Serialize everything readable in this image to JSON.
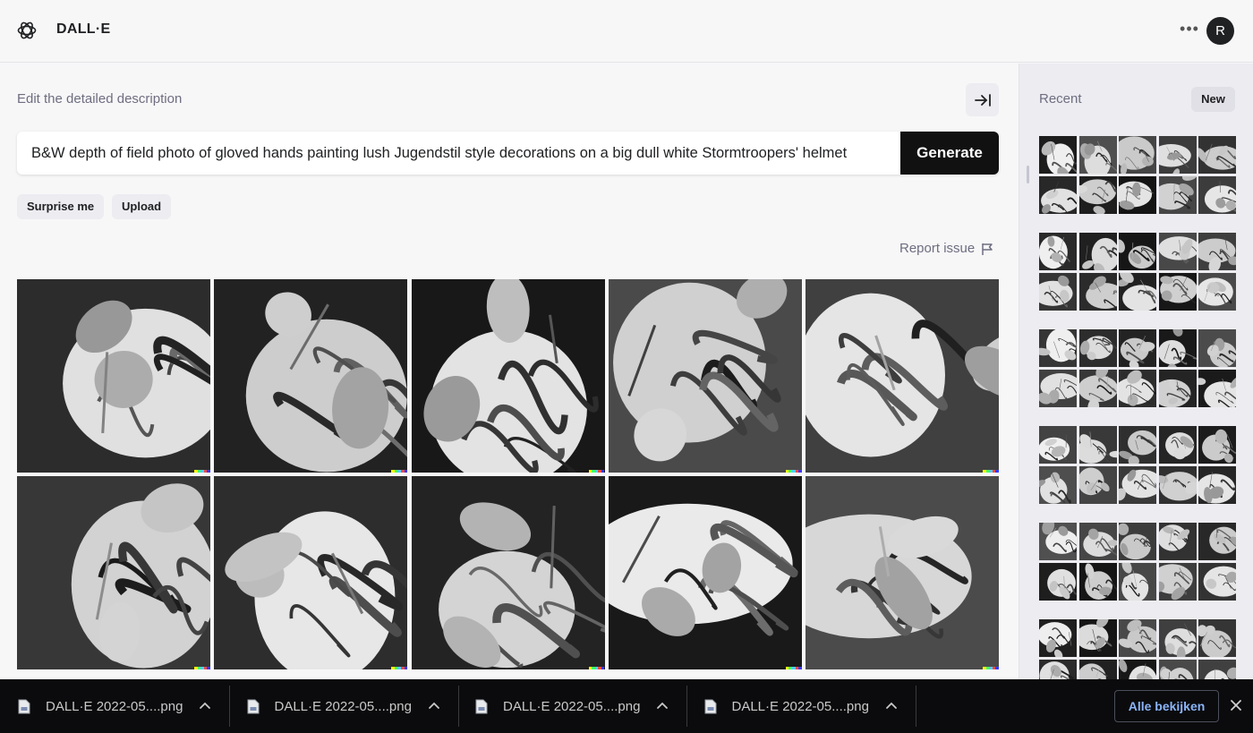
{
  "app": {
    "brand": "DALL·E",
    "avatar_initial": "R",
    "more_icon": "more-horizontal-icon",
    "logo_icon": "openai-logo-icon"
  },
  "editor": {
    "label": "Edit the detailed description",
    "prompt": "B&W depth of field photo of gloved hands painting lush Jugendstil style decorations on a big dull white Stormtroopers' helmet",
    "generate_label": "Generate",
    "surprise_label": "Surprise me",
    "upload_label": "Upload",
    "report_label": "Report issue",
    "collapse_icon": "collapse-sidebar-icon",
    "report_icon": "flag-icon"
  },
  "results": {
    "count": 10,
    "images": [
      {
        "title": "result image 1"
      },
      {
        "title": "result image 2"
      },
      {
        "title": "result image 3"
      },
      {
        "title": "result image 4"
      },
      {
        "title": "result image 5"
      },
      {
        "title": "result image 6"
      },
      {
        "title": "result image 7"
      },
      {
        "title": "result image 8"
      },
      {
        "title": "result image 9"
      },
      {
        "title": "result image 10"
      }
    ],
    "stamp_colors": [
      "#fef200",
      "#43ff65",
      "#50cbff",
      "#f04b3f",
      "#3539f7"
    ]
  },
  "sidebar": {
    "recent_label": "Recent",
    "new_label": "New",
    "batch_count": 6,
    "thumbs_per_batch": 10
  },
  "downloads": {
    "items": [
      {
        "filename": "DALL·E 2022-05....png"
      },
      {
        "filename": "DALL·E 2022-05....png"
      },
      {
        "filename": "DALL·E 2022-05....png"
      },
      {
        "filename": "DALL·E 2022-05....png"
      }
    ],
    "show_all_label": "Alle bekijken",
    "file_icon": "file-icon",
    "caret_icon": "chevron-up-icon",
    "close_icon": "close-icon"
  }
}
